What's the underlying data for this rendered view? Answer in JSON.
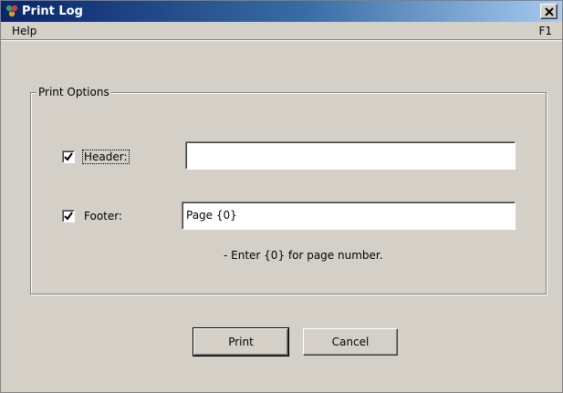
{
  "window": {
    "title": "Print Log",
    "close_glyph": "✕"
  },
  "menu": {
    "help_label": "Help",
    "help_shortcut": "F1"
  },
  "print_options": {
    "group_label": "Print Options",
    "header": {
      "label": "Header:",
      "checked": true,
      "value": ""
    },
    "footer": {
      "label": "Footer:",
      "checked": true,
      "value": "Page {0}"
    },
    "hint": "- Enter {0} for page number."
  },
  "buttons": {
    "print_label": "Print",
    "cancel_label": "Cancel"
  },
  "icons": {
    "app_icon": "app-logo-icon",
    "close_icon": "close-icon",
    "check_icon": "checkmark-icon"
  }
}
